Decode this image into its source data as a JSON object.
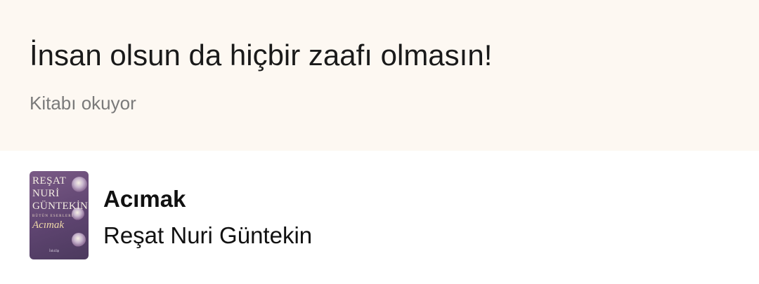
{
  "quote": {
    "text": "İnsan olsun da hiçbir zaafı olmasın!",
    "status": "Kitabı okuyor"
  },
  "book": {
    "title": "Acımak",
    "author": "Reşat Nuri Güntekin",
    "cover": {
      "author_line1": "REŞAT",
      "author_line2": "NURİ",
      "author_line3": "GÜNTEKİN",
      "series": "BÜTÜN ESERLERİ",
      "title": "Acımak",
      "publisher": "İnkılâp",
      "background_color": "#5e4470"
    }
  },
  "colors": {
    "quote_background": "#fdf8f2",
    "primary_text": "#1a1a1a",
    "secondary_text": "#7a7a7a"
  }
}
